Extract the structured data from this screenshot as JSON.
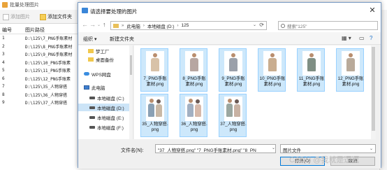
{
  "background_app": {
    "title": "批量处理图片",
    "toolbar": {
      "add_image": "添加图片",
      "add_folder": "添加文件夹"
    },
    "table": {
      "headers": [
        "编号",
        "图片路径"
      ],
      "rows": [
        [
          "1",
          "D:\\125\\7_PNG手账素材"
        ],
        [
          "2",
          "D:\\125\\8_PNG手账素材"
        ],
        [
          "3",
          "D:\\125\\9_PNG手账素材"
        ],
        [
          "4",
          "D:\\125\\10_PNG手账素"
        ],
        [
          "5",
          "D:\\125\\11_PNG手账素"
        ],
        [
          "6",
          "D:\\125\\12_PNG手账素"
        ],
        [
          "7",
          "D:\\125\\35_人物穿搭"
        ],
        [
          "8",
          "D:\\125\\36_人物穿搭"
        ],
        [
          "9",
          "D:\\125\\37_人物穿搭"
        ]
      ]
    }
  },
  "dialog": {
    "title": "请选择要处理的图片",
    "close_glyph": "✕",
    "nav": {
      "back": "←",
      "forward": "→",
      "dropdown": "⌄",
      "up": "↑"
    },
    "address": {
      "separator": "»",
      "crumbs": [
        "此电脑",
        "本地磁盘 (D:)",
        "125"
      ],
      "dropdown": "⌄",
      "refresh": "⟳"
    },
    "search": {
      "placeholder": "搜索\"125\""
    },
    "commands": {
      "organize": "组织 ▾",
      "new_folder": "新建文件夹",
      "view_icon": "▦ ▾",
      "help_icon": "?"
    },
    "nav_pane": [
      {
        "label": "梦工厂",
        "icon": "folder"
      },
      {
        "label": "桌面备份",
        "icon": "folder"
      },
      {
        "label": "WPS网盘",
        "icon": "cloud"
      },
      {
        "label": "此电脑",
        "icon": "pc"
      },
      {
        "label": "本地磁盘 (C:)",
        "icon": "drive"
      },
      {
        "label": "本地磁盘 (D:)",
        "icon": "drive",
        "selected": true
      },
      {
        "label": "本地磁盘 (E:)",
        "icon": "drive"
      },
      {
        "label": "本地磁盘 (F:)",
        "icon": "drive"
      }
    ],
    "files": [
      {
        "label": "7_PNG手账素材.png",
        "color": "#d8c2a8",
        "selected": true
      },
      {
        "label": "8_PNG手账素材.png",
        "color": "#b7a6a1",
        "selected": true
      },
      {
        "label": "9_PNG手账素材.png",
        "color": "#9aa0aa",
        "selected": true
      },
      {
        "label": "10_PNG手账素材.png",
        "color": "#c9ad8f",
        "selected": true
      },
      {
        "label": "11_PNG手账素材.png",
        "color": "#7f8f84",
        "selected": true
      },
      {
        "label": "12_PNG手账素材.png",
        "color": "#b9aa9a",
        "selected": true
      },
      {
        "label": "35_人物穿搭.png",
        "color": "#8aa0b4",
        "color2": "#c9b8a5",
        "selected": true
      },
      {
        "label": "36_人物穿搭.png",
        "color": "#a2b0c2",
        "color2": "#d6b9aa",
        "selected": true
      },
      {
        "label": "37_人物穿搭.png",
        "color": "#9ba7a0",
        "color2": "#c8b2a3",
        "selected": true
      }
    ],
    "filename": {
      "label": "文件名(N):",
      "value": "\"37_人物穿搭.png\" \"7_PNG手账素材.png\" \"8_PN",
      "dropdown": "⌄"
    },
    "filetype": {
      "value": "图片文件",
      "dropdown": "⌄"
    },
    "buttons": {
      "open": "打开(O)",
      "cancel": "取消"
    }
  },
  "watermark": "CSDN @我就是逗逗",
  "colors": {
    "accent": "#0078d7",
    "selection": "#cde8fb",
    "arrow": "#e02020"
  }
}
